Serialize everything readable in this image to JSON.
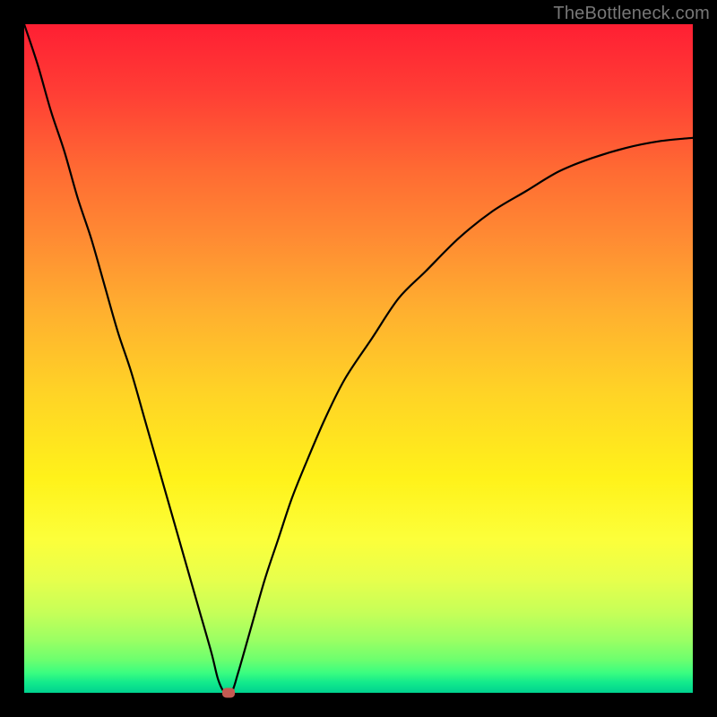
{
  "watermark": "TheBottleneck.com",
  "colors": {
    "frame": "#000000",
    "curve": "#000000",
    "marker": "#c45a52",
    "gradient_top": "#ff1f33",
    "gradient_bottom": "#00d28f"
  },
  "chart_data": {
    "type": "line",
    "title": "",
    "xlabel": "",
    "ylabel": "",
    "xlim": [
      0,
      100
    ],
    "ylim": [
      0,
      100
    ],
    "x": [
      0,
      2,
      4,
      6,
      8,
      10,
      12,
      14,
      16,
      18,
      20,
      22,
      24,
      26,
      28,
      29,
      30,
      31,
      32,
      34,
      36,
      38,
      40,
      42,
      45,
      48,
      52,
      56,
      60,
      65,
      70,
      75,
      80,
      85,
      90,
      95,
      100
    ],
    "values": [
      100,
      94,
      87,
      81,
      74,
      68,
      61,
      54,
      48,
      41,
      34,
      27,
      20,
      13,
      6,
      2,
      0,
      0,
      3,
      10,
      17,
      23,
      29,
      34,
      41,
      47,
      53,
      59,
      63,
      68,
      72,
      75,
      78,
      80,
      81.5,
      82.5,
      83
    ],
    "marker": {
      "x": 30.5,
      "y": 0
    },
    "notes": "y is bottleneck percentage (0 = ideal, 100 = worst); curve dips to zero at the optimum near x≈30 then rises asymptotically."
  }
}
